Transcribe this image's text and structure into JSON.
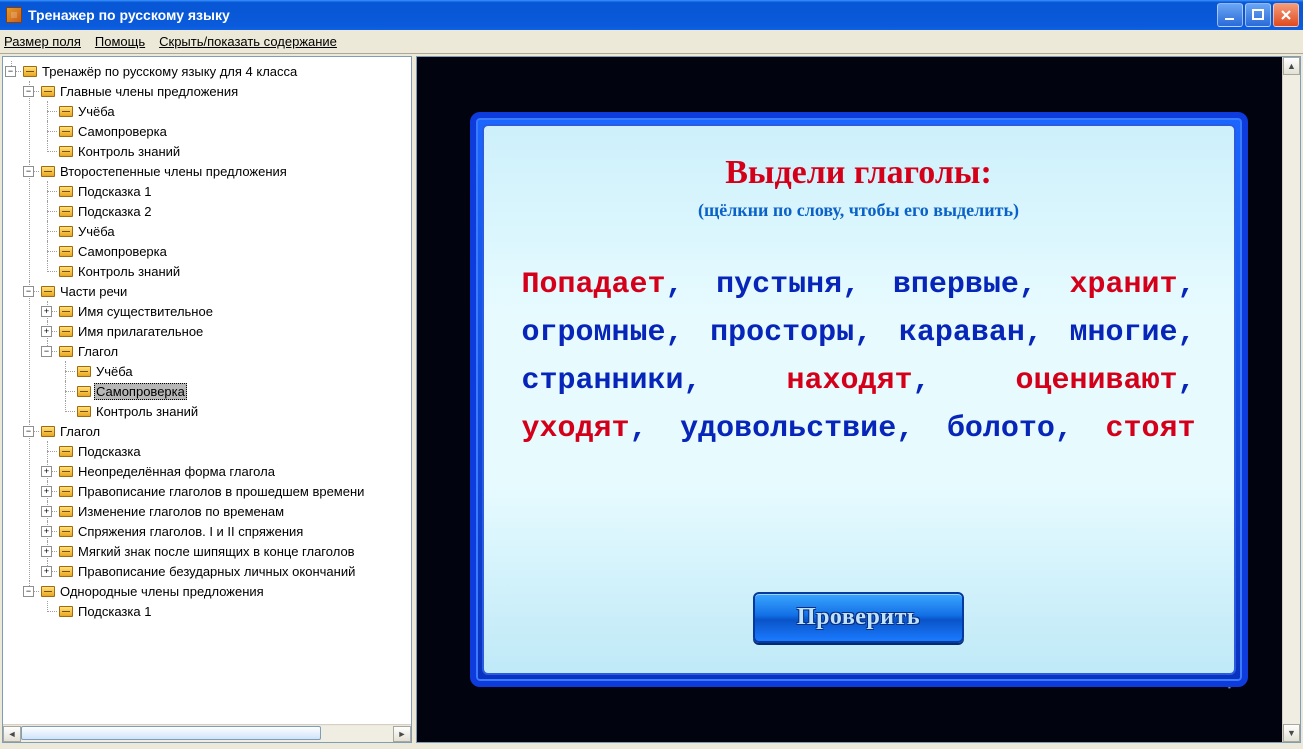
{
  "window": {
    "title": "Тренажер по русскому языку"
  },
  "menu": {
    "field_size": "Размер поля",
    "help": "Помощь",
    "toggle_toc": "Скрыть/показать содержание"
  },
  "tree": {
    "root": "Тренажёр по русскому языку для 4 класса",
    "n1": "Главные члены предложения",
    "n1_1": "Учёба",
    "n1_2": "Самопроверка",
    "n1_3": "Контроль знаний",
    "n2": "Второстепенные члены предложения",
    "n2_1": "Подсказка 1",
    "n2_2": "Подсказка 2",
    "n2_3": "Учёба",
    "n2_4": "Самопроверка",
    "n2_5": "Контроль знаний",
    "n3": "Части речи",
    "n3_1": "Имя существительное",
    "n3_2": "Имя прилагательное",
    "n3_3": "Глагол",
    "n3_3_1": "Учёба",
    "n3_3_2": "Самопроверка",
    "n3_3_3": "Контроль знаний",
    "n4": "Глагол",
    "n4_1": "Подсказка",
    "n4_2": "Неопределённая форма глагола",
    "n4_3": "Правописание глаголов в прошедшем времени",
    "n4_4": "Изменение глаголов по временам",
    "n4_5": "Спряжения глаголов. I и II спряжения",
    "n4_6": "Мягкий знак после шипящих в конце глаголов",
    "n4_7": "Правописание безударных личных окончаний",
    "n5": "Однородные члены предложения",
    "n5_1": "Подсказка 1"
  },
  "exercise": {
    "title": "Выдели глаголы:",
    "subtitle": "(щёлкни по слову, чтобы его выделить)",
    "words": [
      {
        "t": "Попадает",
        "sel": true
      },
      {
        "t": "пустыня",
        "sel": false
      },
      {
        "t": "впервые",
        "sel": false
      },
      {
        "t": "хранит",
        "sel": true
      },
      {
        "t": "огромные",
        "sel": false
      },
      {
        "t": "просторы",
        "sel": false
      },
      {
        "t": "караван",
        "sel": false
      },
      {
        "t": "многие",
        "sel": false
      },
      {
        "t": "странники",
        "sel": false
      },
      {
        "t": "находят",
        "sel": true
      },
      {
        "t": "оценивают",
        "sel": true
      },
      {
        "t": "уходят",
        "sel": true
      },
      {
        "t": "удовольствие",
        "sel": false
      },
      {
        "t": "болото",
        "sel": false
      },
      {
        "t": "стоят",
        "sel": true
      }
    ],
    "check_button": "Проверить"
  }
}
